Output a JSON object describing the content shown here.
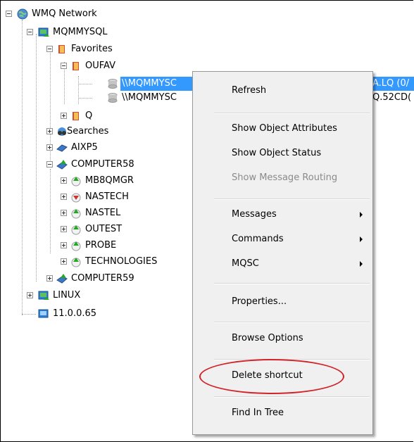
{
  "tree": {
    "root": "WMQ Network",
    "mqmmysql": "MQMMYSQL",
    "favorites": "Favorites",
    "oufav": "OUFAV",
    "fav_item_1": "\\\\MQMMYSC",
    "fav_item_1_tail": "A.LQ (0/",
    "fav_item_2": "\\\\MQMMYSC",
    "fav_item_2_tail": "Q.52CD(",
    "q": "Q",
    "searches": "Searches",
    "aixp5": "AIXP5",
    "computer58": "COMPUTER58",
    "mb8qmgr": "MB8QMGR",
    "nastech": "NASTECH",
    "nastel": "NASTEL",
    "outest": "OUTEST",
    "probe": "PROBE",
    "technologies": "TECHNOLOGIES",
    "computer59": "COMPUTER59",
    "linux": "LINUX",
    "ip": "11.0.0.65"
  },
  "menu": {
    "refresh": "Refresh",
    "show_attributes": "Show Object Attributes",
    "show_status": "Show Object Status",
    "show_routing": "Show Message Routing",
    "messages": "Messages",
    "commands": "Commands",
    "mqsc": "MQSC",
    "properties": "Properties...",
    "browse_options": "Browse Options",
    "delete_shortcut": "Delete shortcut",
    "find_in_tree": "Find In Tree"
  },
  "colors": {
    "selection": "#3399ff",
    "highlight_ellipse": "#d2232a",
    "qmgr_green": "#2eae2e",
    "qmgr_red": "#d0312d"
  }
}
